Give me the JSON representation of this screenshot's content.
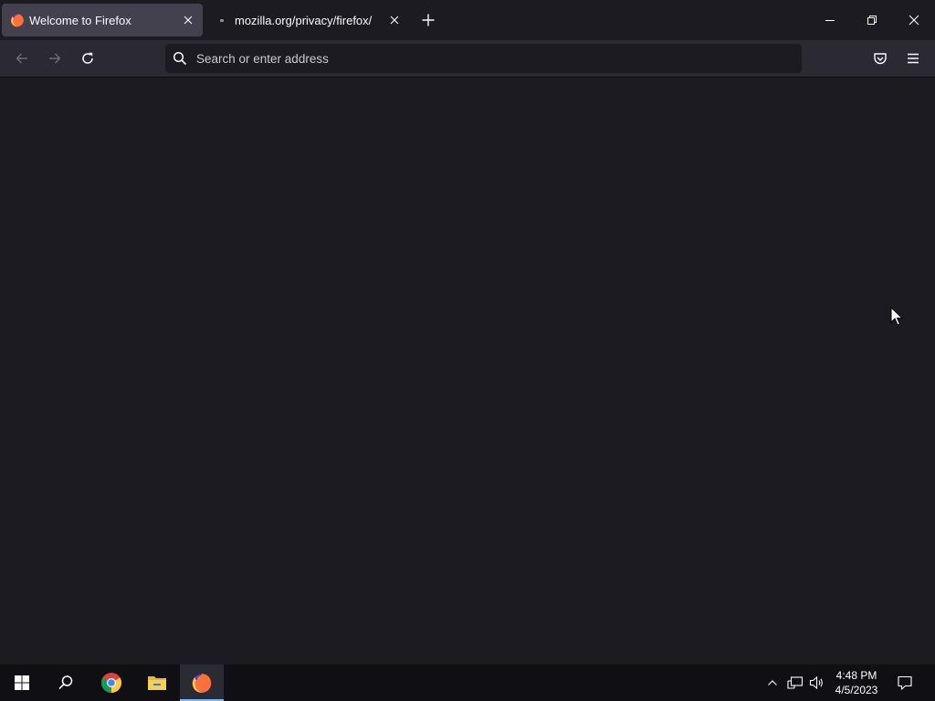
{
  "browser": {
    "tabs": [
      {
        "title": "Welcome to Firefox",
        "active": true,
        "favicon": "firefox-icon"
      },
      {
        "title": "mozilla.org/privacy/firefox/",
        "active": false,
        "favicon": "loading-dot"
      }
    ],
    "new_tab_icon": "plus-icon",
    "window_controls": [
      "minimize-icon",
      "restore-icon",
      "close-icon"
    ],
    "nav": {
      "back_icon": "arrow-left-icon",
      "forward_icon": "arrow-right-icon",
      "reload_icon": "reload-icon"
    },
    "urlbar": {
      "placeholder": "Search or enter address",
      "value": ""
    },
    "toolbar_right": [
      "pocket-icon",
      "hamburger-menu-icon"
    ],
    "colors": {
      "tabstrip_bg": "#1c1b22",
      "active_tab_bg": "#42414d",
      "toolbar_bg": "#2b2a33",
      "urlbar_bg": "#1c1b22",
      "content_bg": "#1c1b22"
    }
  },
  "taskbar": {
    "pinned": [
      "windows-start-icon",
      "search-icon",
      "chrome-icon",
      "file-explorer-icon",
      "firefox-icon"
    ],
    "active_app": "firefox-icon",
    "tray_icons": [
      "chevron-up-icon",
      "network-icon",
      "volume-icon"
    ],
    "clock": {
      "time": "4:48 PM",
      "date": "4/5/2023"
    },
    "notifications_icon": "action-center-icon",
    "accent": "#76b9ed"
  }
}
